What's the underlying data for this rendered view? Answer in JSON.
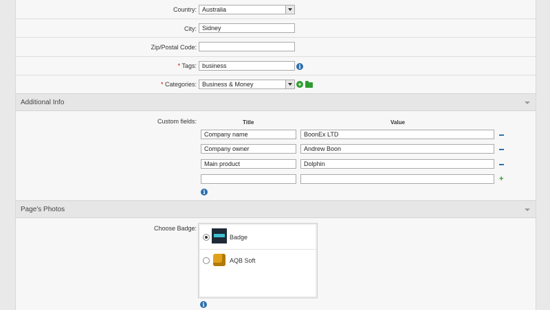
{
  "location": {
    "country_label": "Country:",
    "country_value": "Australia",
    "city_label": "City:",
    "city_value": "Sidney",
    "zip_label": "Zip/Postal Code:",
    "zip_value": ""
  },
  "tags": {
    "required_mark": "*",
    "label": "Tags:",
    "value": "business"
  },
  "categories": {
    "required_mark": "*",
    "label": "Categories:",
    "value": "Business & Money"
  },
  "additional_info": {
    "header": "Additional Info",
    "custom_fields_label": "Custom fields:",
    "title_header": "Title",
    "value_header": "Value",
    "rows": [
      {
        "title": "Company name",
        "value": "BoonEx LTD"
      },
      {
        "title": "Company owner",
        "value": "Andrew Boon"
      },
      {
        "title": "Main product",
        "value": "Dolphin"
      },
      {
        "title": "",
        "value": ""
      }
    ]
  },
  "photos": {
    "header": "Page's Photos",
    "choose_badge_label": "Choose Badge:",
    "badges": [
      {
        "label": "Badge",
        "selected": true
      },
      {
        "label": "AQB Soft",
        "selected": false
      }
    ]
  },
  "icons": {
    "info": "info-icon",
    "add": "plus-circle-icon",
    "folder": "folder-icon",
    "remove": "minus-icon",
    "collapse": "chevron-down-icon"
  },
  "colors": {
    "required": "#d00000",
    "info": "#2b6fad",
    "add": "#2f9c2f"
  }
}
